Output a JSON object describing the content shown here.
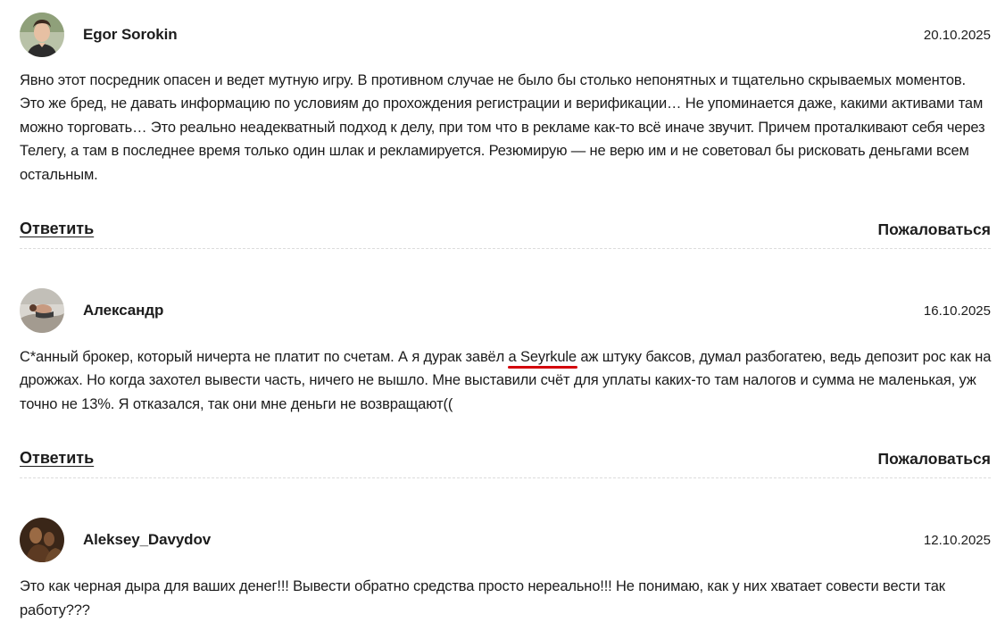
{
  "comments": [
    {
      "author": "Egor Sorokin",
      "date": "20.10.2025",
      "avatar_icon": "user-photo-avatar",
      "text": "Явно этот посредник опасен и ведет мутную игру. В противном случае не было бы столько непонятных и тщательно скрываемых моментов. Это же бред, не давать информацию по условиям до прохождения регистрации и верификации… Не упоминается даже, какими активами там можно торговать… Это реально неадекватный подход к делу, при том что в рекламе как-то всё иначе звучит. Причем проталкивают себя через Телегу, а там в последнее время только один шлак и рекламируется. Резюмирую — не верю им и не советовал бы рисковать деньгами всем остальным.",
      "reply_label": "Ответить",
      "report_label": "Пожаловаться"
    },
    {
      "author": "Александр",
      "date": "16.10.2025",
      "avatar_icon": "user-photo-avatar",
      "text_before": "С*анный брокер, который ничерта не платит по счетам. А я дурак завёл ",
      "mention": "а Seyrkule",
      "text_after": " аж штуку баксов, думал разбогатею, ведь депозит рос как на дрожжах. Но когда захотел вывести часть, ничего не вышло. Мне выставили счёт для уплаты каких-то там налогов и сумма не маленькая, уж точно не 13%. Я отказался, так они мне деньги не возвращают((",
      "mention_underline_color": "#d4000a",
      "reply_label": "Ответить",
      "report_label": "Пожаловаться"
    },
    {
      "author": "Aleksey_Davydov",
      "date": "12.10.2025",
      "avatar_icon": "user-photo-avatar",
      "text": "Это как черная дыра для ваших денег!!! Вывести обратно средства просто нереально!!! Не понимаю, как у них хватает совести вести так работу???"
    }
  ]
}
